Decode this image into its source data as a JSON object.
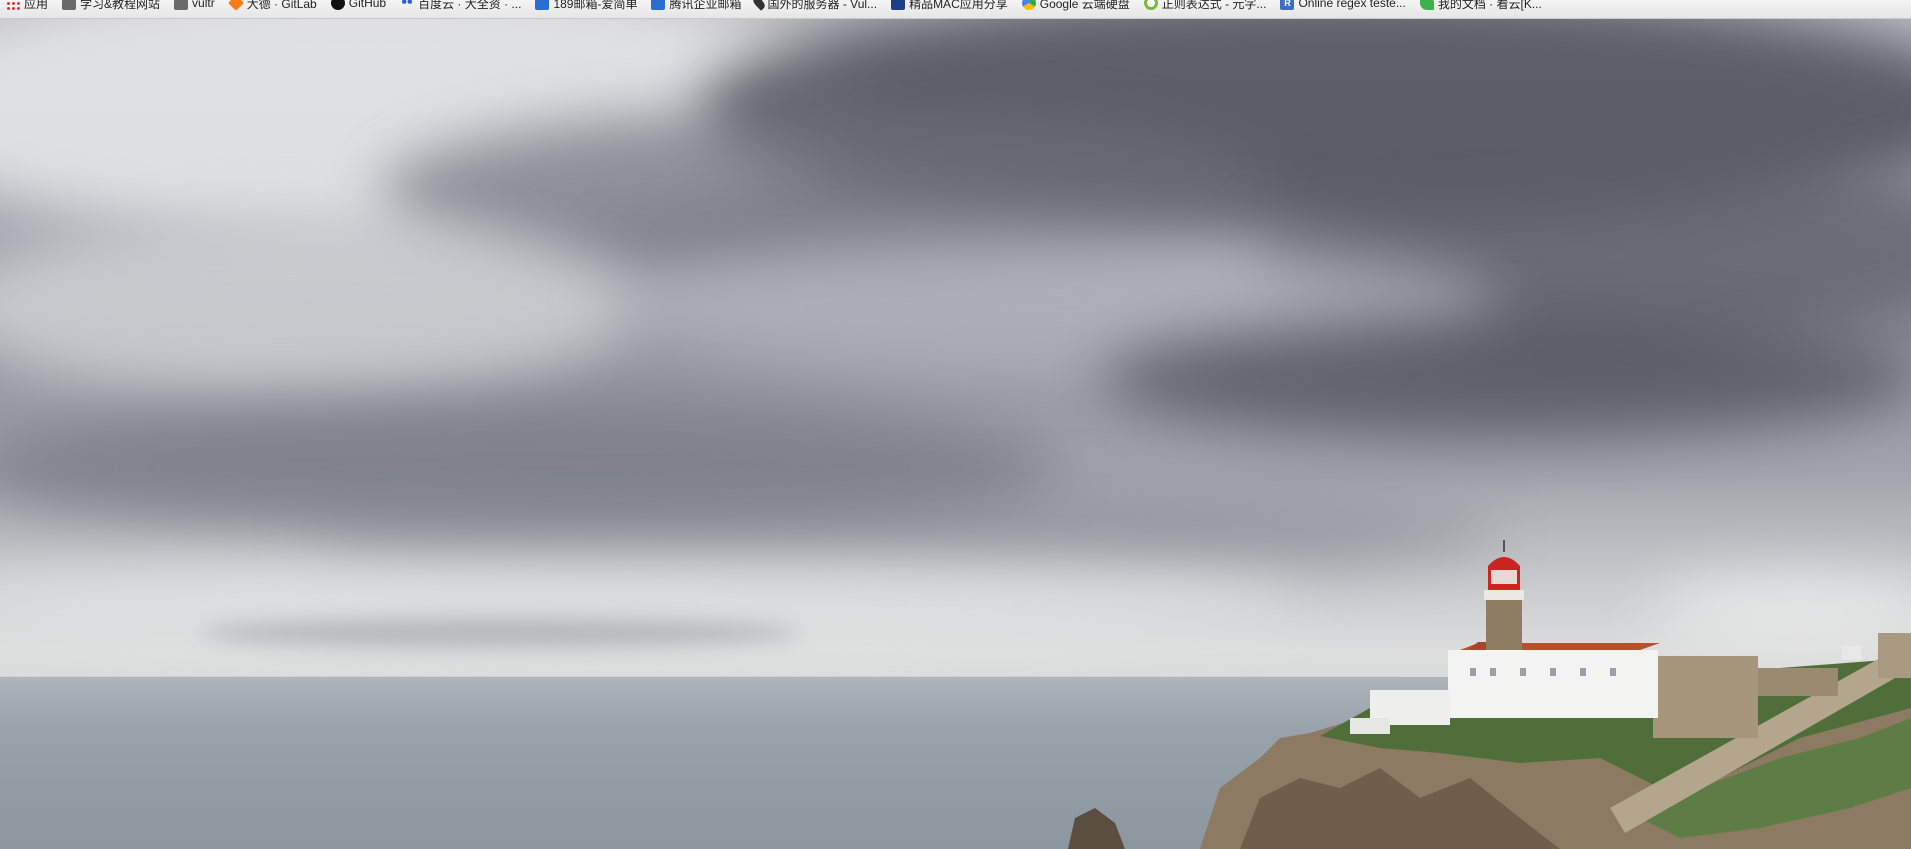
{
  "bookmarks": [
    {
      "label": "应用",
      "icon": "apps-grid-icon"
    },
    {
      "label": "学习&教程网站",
      "icon": "folder-icon"
    },
    {
      "label": "vultr",
      "icon": "folder-icon"
    },
    {
      "label": "大德 · GitLab",
      "icon": "gitlab-icon"
    },
    {
      "label": "GitHub",
      "icon": "github-icon"
    },
    {
      "label": "百度云 · 大全资 · ...",
      "icon": "baidu-icon"
    },
    {
      "label": "189邮箱-爱简单",
      "icon": "mail-189-icon"
    },
    {
      "label": "腾讯企业邮箱",
      "icon": "tencent-mail-icon"
    },
    {
      "label": "国外的服务器 - Vul...",
      "icon": "location-pin-icon"
    },
    {
      "label": "精品MAC应用分享",
      "icon": "mac-app-icon"
    },
    {
      "label": "Google 云端硬盘",
      "icon": "google-drive-icon"
    },
    {
      "label": "正则表达式 - 元字...",
      "icon": "regex-circle-icon"
    },
    {
      "label": "Online regex teste...",
      "icon": "regex-tester-icon"
    },
    {
      "label": "我的文档 · 看云[K...",
      "icon": "kancloud-icon"
    }
  ],
  "colors": {
    "lighthouse_red": "#c8261e",
    "roof_red": "#b8502c",
    "building_white": "#f3f3f1",
    "fort_stone": "#a5967c",
    "vegetation": "#4f6e3a",
    "cliff": "#8c7a62"
  }
}
